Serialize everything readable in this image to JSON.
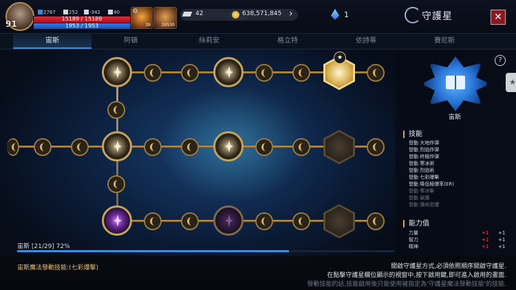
{
  "player": {
    "level": "91",
    "stats": [
      "2767",
      "252",
      "-342",
      "40"
    ],
    "hp_text": "15189 / 15189",
    "hp_ratio": 1.0,
    "mp_text": "1953 / 1953",
    "mp_ratio": 1.0
  },
  "quick_slots": [
    "39",
    "20530"
  ],
  "currency": {
    "feather": "42",
    "gold": "638,571,845",
    "crystal": "1"
  },
  "page_title": "守護星",
  "tabs": [
    "宙斯",
    "阿頓",
    "絲莉安",
    "格立特",
    "依詩蒂",
    "賽尼斯"
  ],
  "active_tab": "宙斯",
  "progress": {
    "text": "宙斯 [21/29] 72%",
    "ratio": 0.72
  },
  "emblem_name": "宙斯",
  "skills_header": "技能",
  "skills": [
    {
      "name": "發動 大地炸彈",
      "active": true
    },
    {
      "name": "發動 烈焰炸彈",
      "active": true
    },
    {
      "name": "發動 终極炸彈",
      "active": true
    },
    {
      "name": "發動 寒冰術",
      "active": true
    },
    {
      "name": "發動 烈焰術",
      "active": true
    },
    {
      "name": "發動 七彩爆擊",
      "active": true
    },
    {
      "name": "發動 降低極爆率(ER)",
      "active": true
    },
    {
      "name": "發動 零冰擊",
      "active": false
    },
    {
      "name": "發動 破護",
      "active": false
    },
    {
      "name": "發動 讀命恐懼",
      "active": false
    }
  ],
  "ability_header": "能力值",
  "abilities": [
    {
      "name": "力量",
      "bonus": "+1",
      "total": "+1"
    },
    {
      "name": "智力",
      "bonus": "+1",
      "total": "+1"
    },
    {
      "name": "精神",
      "bonus": "+1",
      "total": "+1"
    }
  ],
  "magic_skill": "宙斯魔法發動技能:(七彩爆擊)",
  "instructions": [
    "開啟守護星方式,必須依照順序開啟守護星.",
    "在點擊守護星欄位顯示的視窗中,按下啟用鍵,即可進入啟用的畫面.",
    "發動技能的話,技能啟用後只能使用被指定為'守護星魔法發動技能'的技能."
  ]
}
